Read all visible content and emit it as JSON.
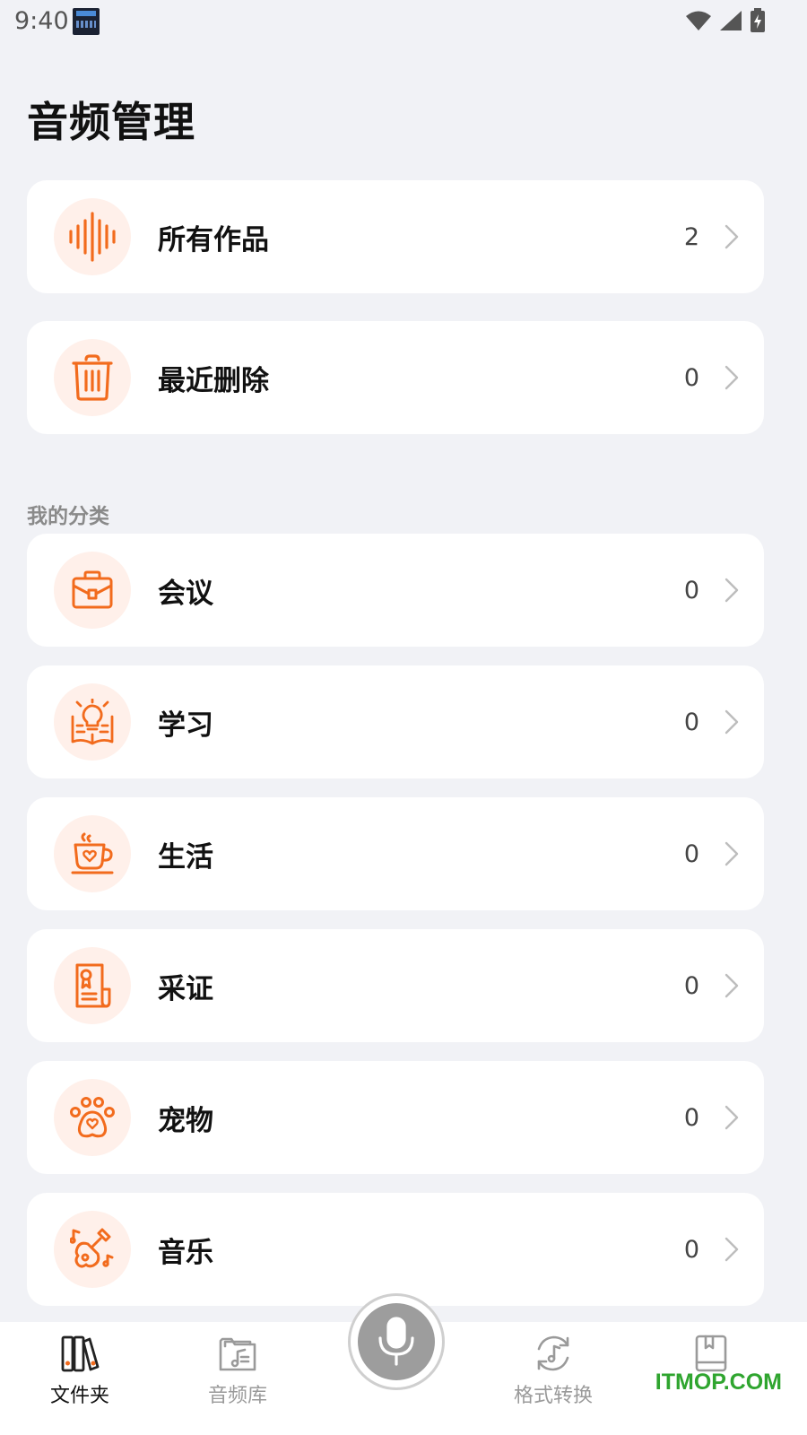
{
  "status_bar": {
    "time": "9:40"
  },
  "title": "音频管理",
  "top_cards": [
    {
      "label": "所有作品",
      "count": "2",
      "icon": "waveform-icon"
    },
    {
      "label": "最近删除",
      "count": "0",
      "icon": "trash-icon"
    }
  ],
  "section_label": "我的分类",
  "categories": [
    {
      "label": "会议",
      "count": "0",
      "icon": "briefcase-icon"
    },
    {
      "label": "学习",
      "count": "0",
      "icon": "lightbulb-book-icon"
    },
    {
      "label": "生活",
      "count": "0",
      "icon": "coffee-cup-icon"
    },
    {
      "label": "采证",
      "count": "0",
      "icon": "certificate-icon"
    },
    {
      "label": "宠物",
      "count": "0",
      "icon": "paw-icon"
    },
    {
      "label": "音乐",
      "count": "0",
      "icon": "guitar-icon"
    }
  ],
  "bottom_nav": {
    "items": [
      {
        "label": "文件夹",
        "icon": "folder-books-icon",
        "active": true
      },
      {
        "label": "音频库",
        "icon": "music-folder-icon",
        "active": false
      },
      {
        "label": "格式转换",
        "icon": "convert-music-icon",
        "active": false
      },
      {
        "label": "",
        "icon": "notebook-icon",
        "active": false
      }
    ],
    "record_icon": "microphone-icon"
  },
  "watermark": "ITMOP.COM",
  "colors": {
    "accent": "#f26b1d",
    "icon_bg": "#fff0ea",
    "page_bg": "#f1f2f6",
    "watermark": "#2fa52f"
  }
}
